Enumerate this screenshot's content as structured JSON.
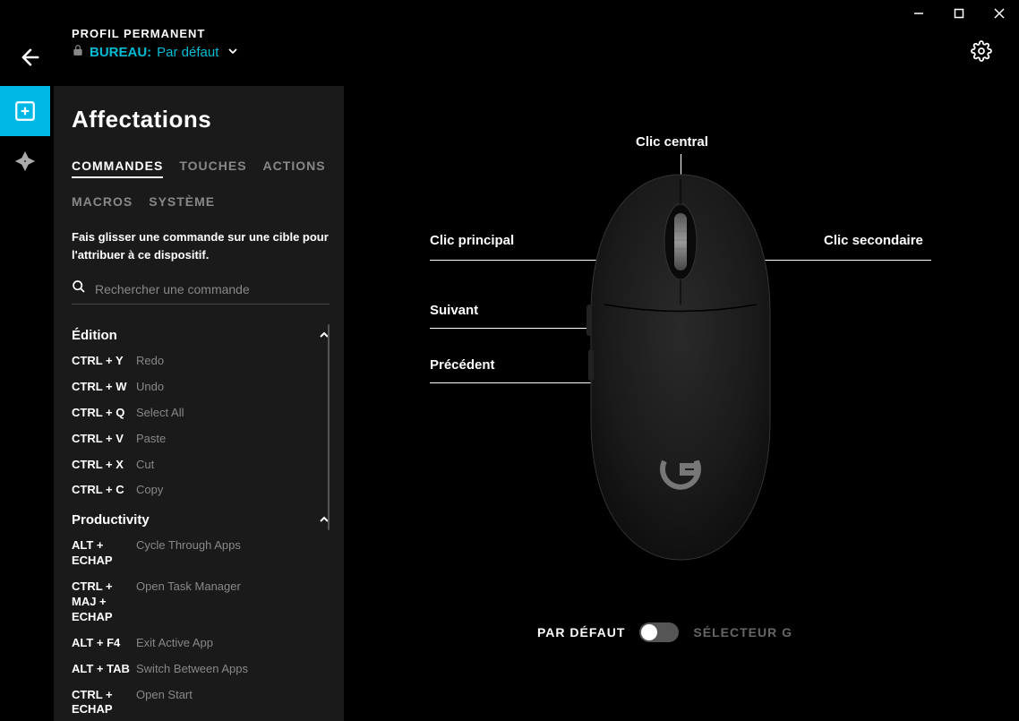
{
  "window": {
    "minimize": "—",
    "maximize": "▢",
    "close": "✕"
  },
  "header": {
    "profile_label": "PROFIL PERMANENT",
    "bureau": "BUREAU:",
    "default": "Par défaut"
  },
  "panel": {
    "title": "Affectations",
    "tabs": [
      "COMMANDES",
      "TOUCHES",
      "ACTIONS",
      "MACROS",
      "SYSTÈME"
    ],
    "active_tab": 0,
    "instruction": "Fais glisser une commande sur une cible pour l'attribuer à ce dispositif.",
    "search_placeholder": "Rechercher une commande"
  },
  "sections": [
    {
      "title": "Édition",
      "items": [
        {
          "keys": "CTRL + Y",
          "label": "Redo"
        },
        {
          "keys": "CTRL + W",
          "label": "Undo"
        },
        {
          "keys": "CTRL + Q",
          "label": "Select All"
        },
        {
          "keys": "CTRL + V",
          "label": "Paste"
        },
        {
          "keys": "CTRL + X",
          "label": "Cut"
        },
        {
          "keys": "CTRL + C",
          "label": "Copy"
        }
      ]
    },
    {
      "title": "Productivity",
      "items": [
        {
          "keys": "ALT + ECHAP",
          "label": "Cycle Through Apps"
        },
        {
          "keys": "CTRL + MAJ + ECHAP",
          "label": "Open Task Manager"
        },
        {
          "keys": "ALT + F4",
          "label": "Exit Active App"
        },
        {
          "keys": "ALT + TAB",
          "label": "Switch Between Apps"
        },
        {
          "keys": "CTRL + ECHAP",
          "label": "Open Start"
        }
      ]
    }
  ],
  "callouts": {
    "middle": "Clic central",
    "primary": "Clic principal",
    "secondary": "Clic secondaire",
    "forward": "Suivant",
    "back": "Précédent"
  },
  "footer": {
    "default": "PAR DÉFAUT",
    "gselector": "SÉLECTEUR G"
  }
}
